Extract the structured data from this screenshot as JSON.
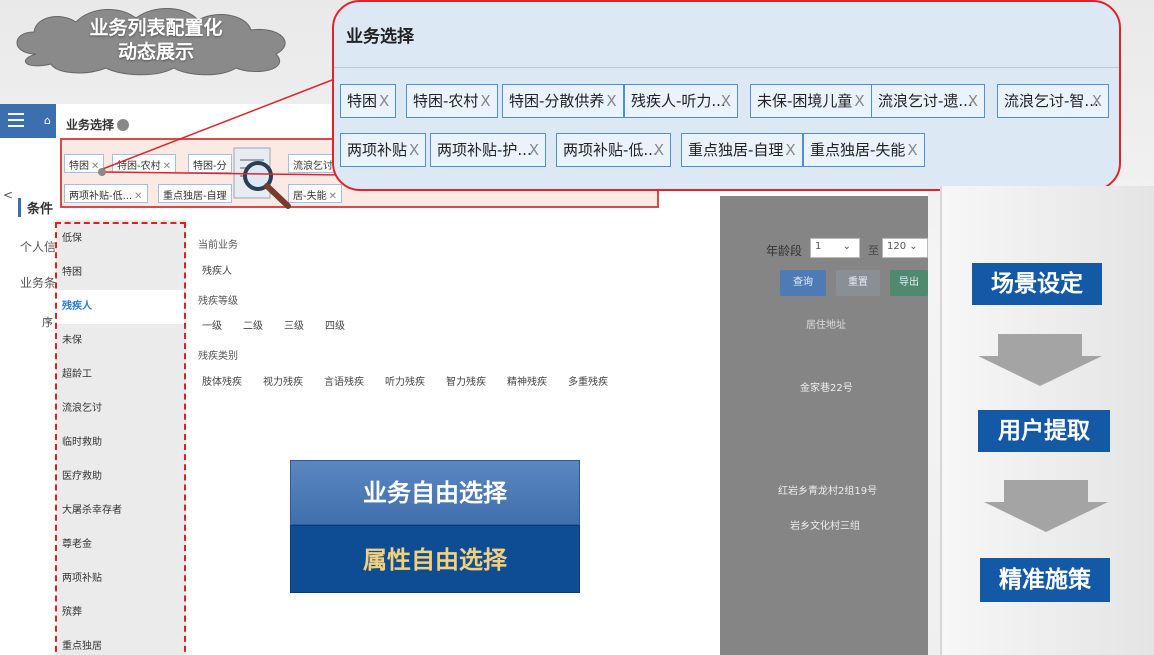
{
  "title": {
    "line1": "业务列表配置化",
    "line2": "动态展示"
  },
  "app": {
    "panel_title": "业务选择",
    "condition_label": "条件",
    "personal_label": "个人信",
    "biz_label": "业务条",
    "seq_label": "序",
    "small_tags": [
      "特困",
      "特困-农村",
      "特困-分",
      "两项补贴-低...",
      "重点独居-自理",
      "居-失能",
      "流浪乞讨"
    ],
    "categories": [
      "低保",
      "特困",
      "残疾人",
      "未保",
      "超龄工",
      "流浪乞讨",
      "临时救助",
      "医疗救助",
      "大屠杀幸存者",
      "尊老金",
      "两项补贴",
      "殡葬",
      "重点独居"
    ],
    "active_category": "残疾人",
    "detail": {
      "current_label": "当前业务",
      "current_value": "残疾人",
      "grade_label": "残疾等级",
      "grades": [
        "一级",
        "二级",
        "三级",
        "四级"
      ],
      "type_label": "残疾类别",
      "types": [
        "肢体残疾",
        "视力残疾",
        "言语残疾",
        "听力残疾",
        "智力残疾",
        "精神残疾",
        "多重残疾"
      ]
    },
    "age": {
      "label": "年龄段",
      "from": "1",
      "to_label": "至",
      "to": "120"
    },
    "buttons": {
      "query": "查询",
      "reset": "重置",
      "export": "导出"
    },
    "column_address": "居住地址",
    "addresses": [
      "金家巷22号",
      "红岩乡青龙村2组19号",
      "岩乡文化村三组"
    ]
  },
  "boxes": {
    "free_business": "业务自由选择",
    "free_attribute": "属性自由选择"
  },
  "callout": {
    "title": "业务选择",
    "row1": [
      "特困",
      "特困-农村",
      "特困-分散供养",
      "残疾人-听力...",
      "未保-困境儿童",
      "流浪乞讨-遗...",
      "流浪乞讨-智..."
    ],
    "row2": [
      "两项补贴",
      "两项补贴-护...",
      "两项补贴-低...",
      "重点独居-自理",
      "重点独居-失能"
    ],
    "close_glyph": "X"
  },
  "flow": {
    "steps": [
      "场景设定",
      "用户提取",
      "精准施策"
    ]
  },
  "colors": {
    "accent": "#1459a6",
    "highlight": "#e0242c",
    "gold": "#f4d07a"
  }
}
